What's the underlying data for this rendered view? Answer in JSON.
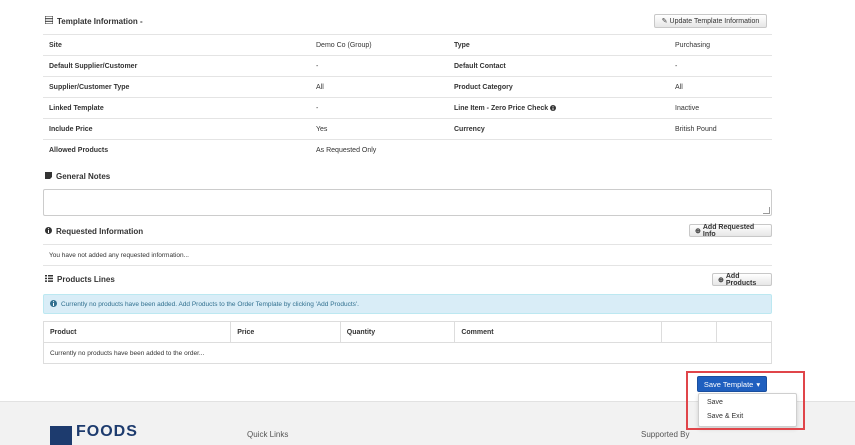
{
  "template_info": {
    "title": "Template Information -",
    "update_button": "Update Template Information",
    "rows": [
      {
        "label1": "Site",
        "value1": "Demo Co (Group)",
        "label2": "Type",
        "value2": "Purchasing"
      },
      {
        "label1": "Default Supplier/Customer",
        "value1": "-",
        "label2": "Default Contact",
        "value2": "-"
      },
      {
        "label1": "Supplier/Customer Type",
        "value1": "All",
        "label2": "Product Category",
        "value2": "All"
      },
      {
        "label1": "Linked Template",
        "value1": "-",
        "label2": "Line Item - Zero Price Check",
        "value2": "Inactive"
      },
      {
        "label1": "Include Price",
        "value1": "Yes",
        "label2": "Currency",
        "value2": "British Pound"
      },
      {
        "label1": "Allowed Products",
        "value1": "As Requested Only",
        "label2": "",
        "value2": ""
      }
    ]
  },
  "general_notes": {
    "title": "General Notes",
    "value": ""
  },
  "requested_info": {
    "title": "Requested Information",
    "add_button": "Add Requested Info",
    "empty_text": "You have not added any requested information..."
  },
  "products": {
    "title": "Products Lines",
    "add_button": "Add Products",
    "alert": "Currently no products have been added. Add Products to the Order Template by clicking 'Add Products'.",
    "columns": [
      "Product",
      "Price",
      "Quantity",
      "Comment",
      "",
      ""
    ],
    "empty_text": "Currently no products have been added to the order..."
  },
  "save_menu": {
    "button": "Save Template",
    "options": [
      "Save",
      "Save & Exit"
    ]
  },
  "footer": {
    "logo_text": "FOODS",
    "quick_links": "Quick Links",
    "supported": "Supported By"
  },
  "colors": {
    "primary": "#1f5fbf",
    "highlight": "#e0454a",
    "alert_bg": "#d9edf7"
  }
}
